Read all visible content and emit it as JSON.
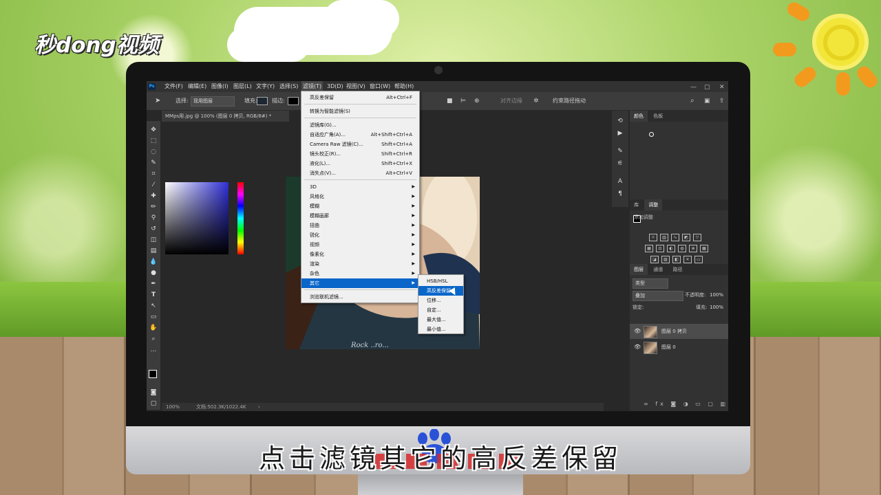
{
  "logo": {
    "text": "秒dong视频"
  },
  "caption": "点击滤镜其它的高反差保留",
  "photoshop": {
    "app_icon": "Ps",
    "menubar": [
      "文件(F)",
      "编辑(E)",
      "图像(I)",
      "图层(L)",
      "文字(Y)",
      "选择(S)",
      "滤镜(T)",
      "3D(D)",
      "视图(V)",
      "窗口(W)",
      "帮助(H)"
    ],
    "window_controls": [
      "—",
      "▢",
      "✕"
    ],
    "options_bar": {
      "select_label": "选择:",
      "select_value": "现用图层",
      "fill_label": "填充:",
      "stroke_label": "描边:",
      "align_edges": "对齐边缘",
      "constrain_path": "约束路径拖动"
    },
    "document_tab": "MMps用.jpg @ 100% (图层 0 拷贝, RGB/8#) *",
    "status_bar": {
      "zoom": "100%",
      "doc": "文档:502.3K/1022.4K"
    },
    "filter_menu": {
      "items": [
        {
          "label": "高反差保留",
          "shortcut": "Alt+Ctrl+F"
        },
        {
          "sep": true
        },
        {
          "label": "转换为智能滤镜(S)",
          "shortcut": ""
        },
        {
          "sep": true
        },
        {
          "label": "滤镜库(G)...",
          "shortcut": ""
        },
        {
          "label": "自适应广角(A)...",
          "shortcut": "Alt+Shift+Ctrl+A"
        },
        {
          "label": "Camera Raw 滤镜(C)...",
          "shortcut": "Shift+Ctrl+A"
        },
        {
          "label": "镜头校正(R)...",
          "shortcut": "Shift+Ctrl+R"
        },
        {
          "label": "液化(L)...",
          "shortcut": "Shift+Ctrl+X"
        },
        {
          "label": "消失点(V)...",
          "shortcut": "Alt+Ctrl+V"
        },
        {
          "sep": true
        },
        {
          "label": "3D",
          "submenu": true
        },
        {
          "label": "风格化",
          "submenu": true
        },
        {
          "label": "模糊",
          "submenu": true
        },
        {
          "label": "模糊画廊",
          "submenu": true
        },
        {
          "label": "扭曲",
          "submenu": true
        },
        {
          "label": "锐化",
          "submenu": true
        },
        {
          "label": "视频",
          "submenu": true
        },
        {
          "label": "像素化",
          "submenu": true
        },
        {
          "label": "渲染",
          "submenu": true
        },
        {
          "label": "杂色",
          "submenu": true
        },
        {
          "label": "其它",
          "submenu": true,
          "highlighted": true
        },
        {
          "sep": true
        },
        {
          "label": "浏览联机滤镜...",
          "shortcut": ""
        }
      ]
    },
    "other_submenu": {
      "items": [
        {
          "label": "HSB/HSL"
        },
        {
          "label": "高反差保留...",
          "highlighted": true
        },
        {
          "label": "位移..."
        },
        {
          "label": "自定..."
        },
        {
          "label": "最大值..."
        },
        {
          "label": "最小值..."
        }
      ]
    },
    "color_panel": {
      "tabs": [
        "颜色",
        "色板"
      ]
    },
    "adjust_panel": {
      "tabs": [
        "库",
        "调整"
      ],
      "title": "添加调整"
    },
    "layers_panel": {
      "tabs": [
        "图层",
        "通道",
        "路径"
      ],
      "kind": "类型",
      "blend_mode": "叠加",
      "opacity_label": "不透明度:",
      "opacity": "100%",
      "lock_label": "锁定:",
      "fill_label": "填充:",
      "fill": "100%",
      "layers": [
        {
          "name": "图层 0 拷贝",
          "selected": true
        },
        {
          "name": "图层 0",
          "selected": false
        }
      ]
    }
  },
  "colors": {
    "menu_highlight": "#0a66c9",
    "ps_dark": "#282828"
  }
}
